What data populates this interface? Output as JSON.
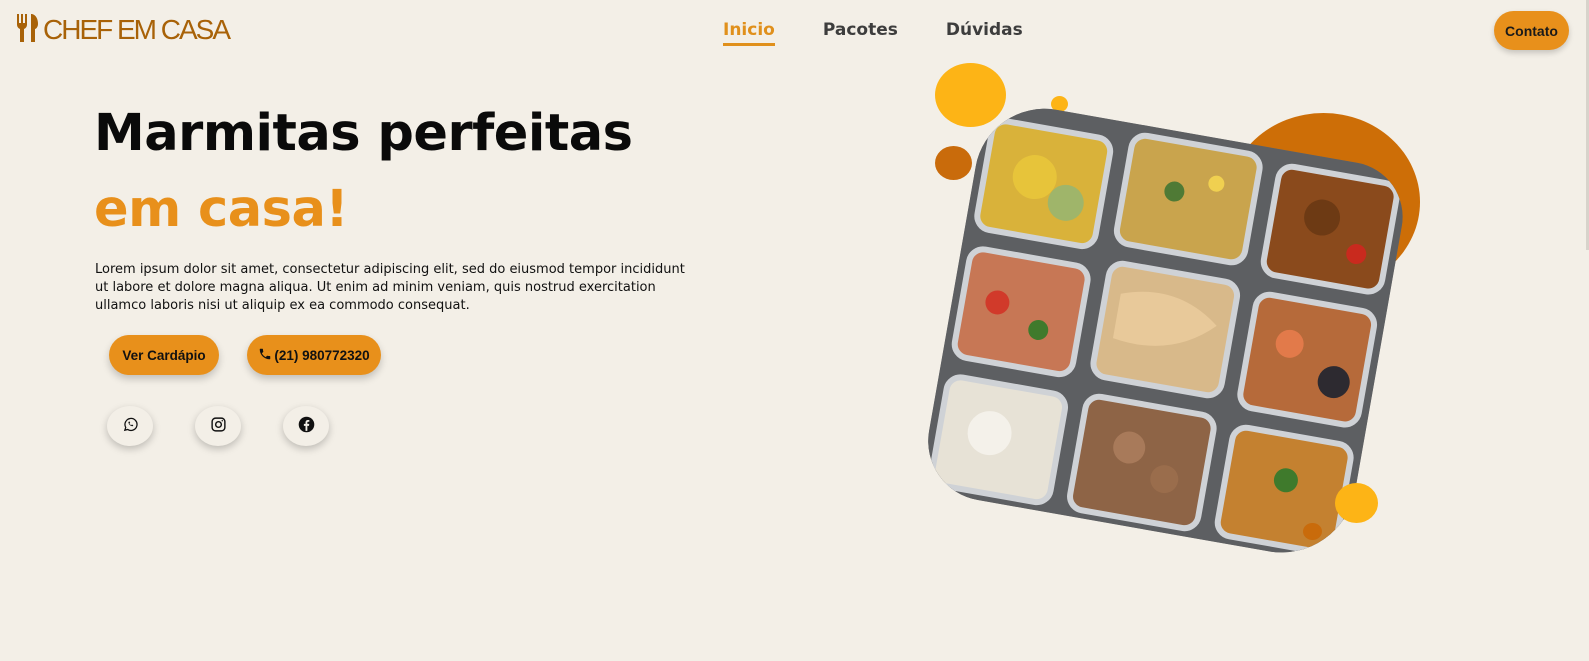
{
  "brand": {
    "name": "CHEF EM CASA",
    "logo_icon": "utensils-icon",
    "color": "#a86208"
  },
  "nav": {
    "items": [
      {
        "label": "Inicio",
        "active": true
      },
      {
        "label": "Pacotes",
        "active": false
      },
      {
        "label": "Dúvidas",
        "active": false
      }
    ],
    "contact_label": "Contato"
  },
  "hero": {
    "title_main": "Marmitas perfeitas ",
    "title_accent": "em casa!",
    "description": "Lorem ipsum dolor sit amet, consectetur adipiscing elit, sed do eiusmod tempor incididunt ut labore et dolore magna aliqua. Ut enim ad minim veniam, quis nostrud exercitation ullamco laboris nisi ut aliquip ex ea commodo consequat.",
    "menu_button": "Ver Cardápio",
    "phone_button": "(21) 980772320",
    "phone_icon": "phone-icon"
  },
  "social": [
    {
      "icon": "whatsapp-icon"
    },
    {
      "icon": "instagram-icon"
    },
    {
      "icon": "facebook-icon"
    }
  ],
  "colors": {
    "background": "#f3efe7",
    "accent": "#e8901b",
    "yellow": "#fdb416",
    "dark_orange": "#cd6e07"
  }
}
